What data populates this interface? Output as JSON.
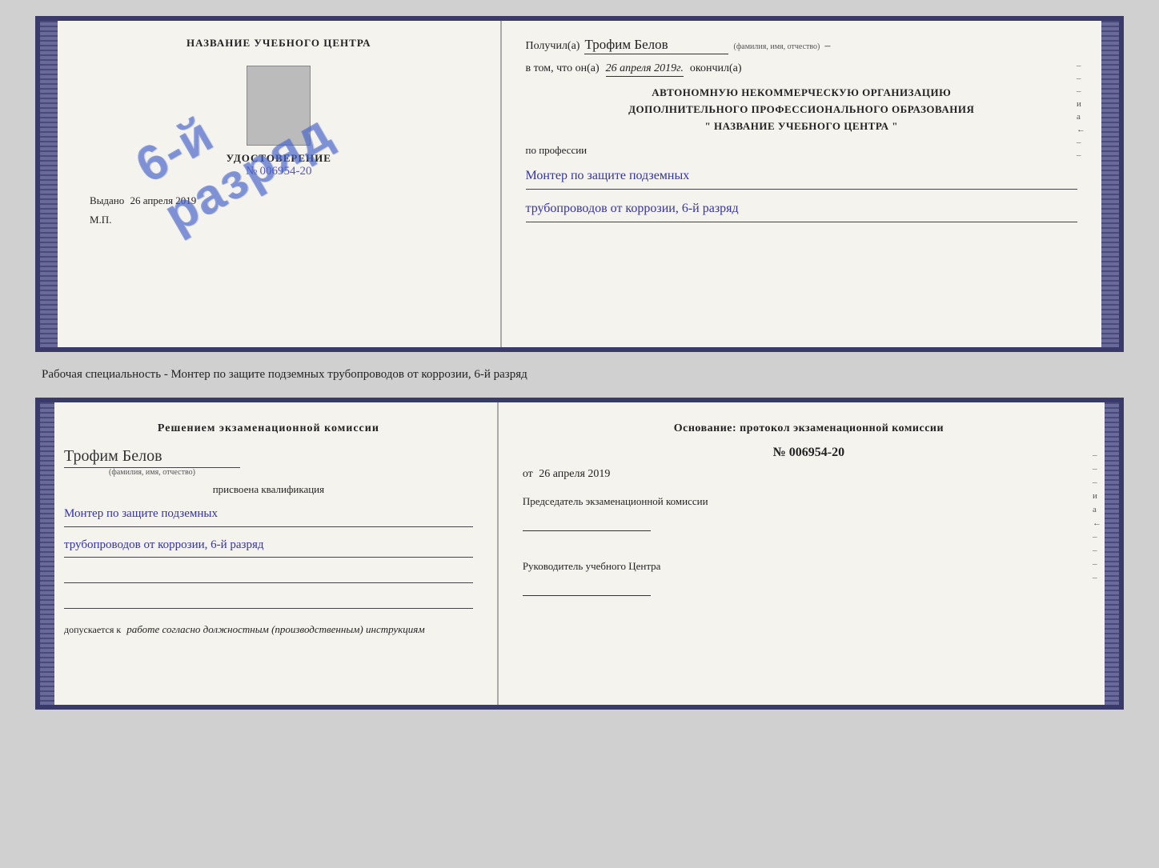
{
  "top_cert": {
    "left": {
      "school_name": "НАЗВАНИЕ УЧЕБНОГО ЦЕНТРА",
      "stamp_line1": "6-й",
      "stamp_line2": "разряд",
      "photo_alt": "фото",
      "udostoverenie_label": "УДОСТОВЕРЕНИЕ",
      "udostoverenie_num_prefix": "№",
      "udostoverenie_num": "006954-20",
      "vydano_label": "Выдано",
      "vydano_date": "26 апреля 2019",
      "mp_label": "М.П."
    },
    "right": {
      "poluchil_label": "Получил(а)",
      "recipient_name": "Трофим Белов",
      "fio_hint": "(фамилия, имя, отчество)",
      "dash": "–",
      "v_tom_label": "в том, что он(а)",
      "date_val": "26 апреля 2019г.",
      "okonchil_label": "окончил(а)",
      "org_line1": "АВТОНОМНУЮ НЕКОММЕРЧЕСКУЮ ОРГАНИЗАЦИЮ",
      "org_line2": "ДОПОЛНИТЕЛЬНОГО ПРОФЕССИОНАЛЬНОГО ОБРАЗОВАНИЯ",
      "org_line3": "\"   НАЗВАНИЕ УЧЕБНОГО ЦЕНТРА   \"",
      "po_professii": "по профессии",
      "profession_line1": "Монтер по защите подземных",
      "profession_line2": "трубопроводов от коррозии, 6-й разряд"
    }
  },
  "middle_text": "Рабочая специальность - Монтер по защите подземных трубопроводов от коррозии, 6-й разряд",
  "bottom_cert": {
    "left": {
      "resheniem_label": "Решением экзаменационной комиссии",
      "name": "Трофим Белов",
      "fio_hint": "(фамилия, имя, отчество)",
      "prisvoena_label": "присвоена квалификация",
      "profession_line1": "Монтер по защите подземных",
      "profession_line2": "трубопроводов от коррозии, 6-й разряд",
      "dopuskaetsya_label": "допускается к",
      "dopuskaetsya_val": "работе согласно должностным (производственным) инструкциям"
    },
    "right": {
      "osnovanie_label": "Основание: протокол экзаменационной комиссии",
      "protocol_prefix": "№",
      "protocol_num": "006954-20",
      "ot_prefix": "от",
      "ot_date": "26 апреля 2019",
      "predsedatel_label": "Председатель экзаменационной комиссии",
      "rukovoditel_label": "Руководитель учебного Центра"
    }
  },
  "vertical_chars": [
    "–",
    "–",
    "–",
    "и",
    "а",
    "←",
    "–",
    "–",
    "–",
    "–"
  ]
}
